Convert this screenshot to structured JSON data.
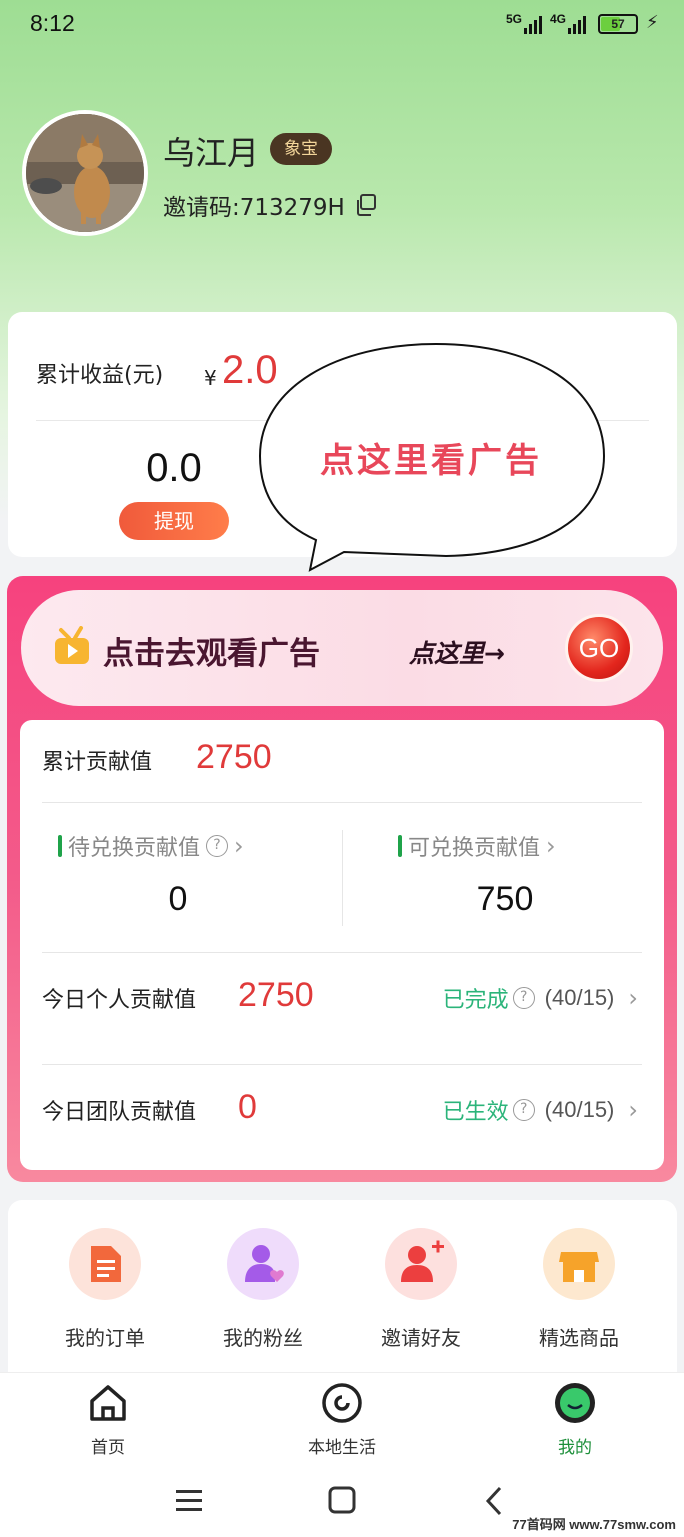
{
  "status_bar": {
    "time": "8:12",
    "net1": "5G",
    "net2": "4G",
    "battery": "57",
    "battery_level": 0.57
  },
  "profile": {
    "name": "乌江月",
    "badge": "象宝",
    "invite_code": "邀请码:713279H"
  },
  "earnings": {
    "label": "累计收益(元)",
    "currency": "¥",
    "total": "2.0",
    "balance": "0.0",
    "withdraw_label": "提现"
  },
  "annotation": {
    "bubble_text": "点这里看广告"
  },
  "ad_banner": {
    "title": "点击去观看广告",
    "hint": "点这里→",
    "go_label": "GO"
  },
  "contribution": {
    "total_label": "累计贡献值",
    "total_value": "2750",
    "pending_label": "待兑换贡献值",
    "pending_value": "0",
    "redeemable_label": "可兑换贡献值",
    "redeemable_value": "750",
    "today_personal_label": "今日个人贡献值",
    "today_personal_value": "2750",
    "today_personal_status": "已完成",
    "today_personal_progress": "(40/15)",
    "today_team_label": "今日团队贡献值",
    "today_team_value": "0",
    "today_team_status": "已生效",
    "today_team_progress": "(40/15)",
    "help_glyph": "?",
    "chevron": "›"
  },
  "quick_actions": [
    {
      "label": "我的订单",
      "icon": "order-icon",
      "color": "#f2683c"
    },
    {
      "label": "我的粉丝",
      "icon": "fans-icon",
      "color": "#a45be8"
    },
    {
      "label": "邀请好友",
      "icon": "invite-friend-icon",
      "color": "#ec3f3f"
    },
    {
      "label": "精选商品",
      "icon": "shop-icon",
      "color": "#f6a32a"
    }
  ],
  "tab_bar": [
    {
      "label": "首页",
      "icon": "home-icon",
      "active": false
    },
    {
      "label": "本地生活",
      "icon": "local-life-icon",
      "active": false
    },
    {
      "label": "我的",
      "icon": "profile-icon",
      "active": true
    }
  ],
  "watermark": "77首码网 www.77smw.com"
}
